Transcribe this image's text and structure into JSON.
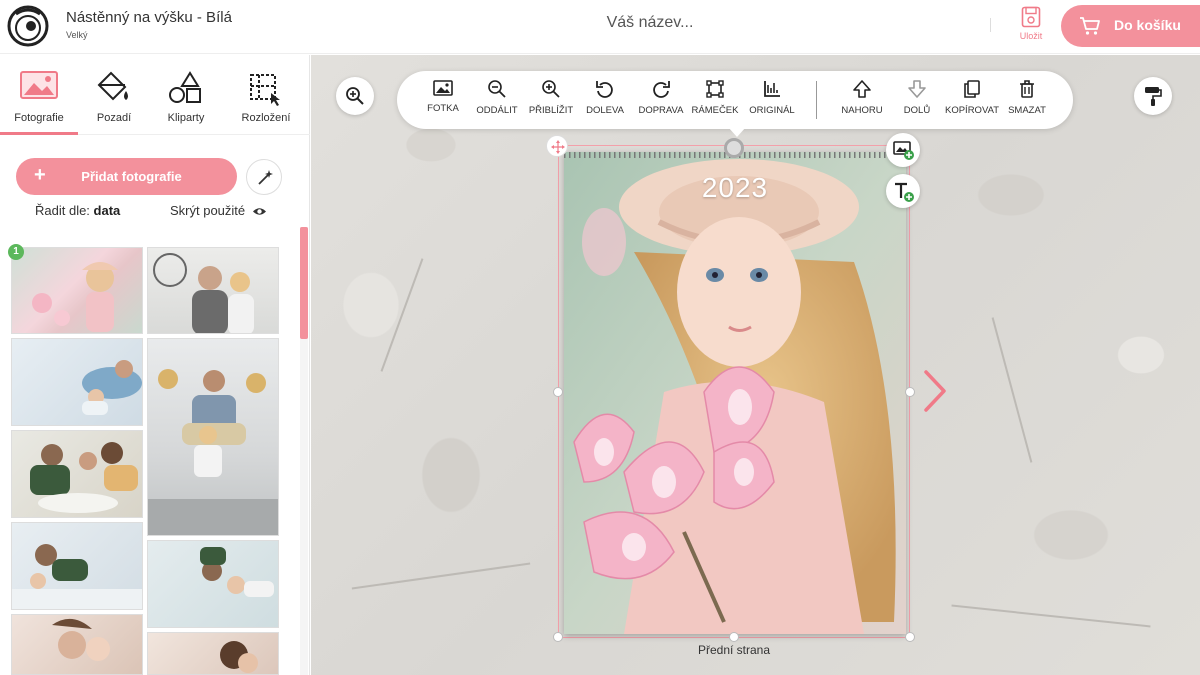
{
  "header": {
    "product_title": "Nástěnný na výšku - Bílá",
    "product_size": "Velký",
    "document_name": "Váš název...",
    "save_label": "Uložit",
    "cart_label": "Do košíku",
    "accent_color": "#f3919c"
  },
  "sidebar": {
    "tabs": [
      {
        "label": "Fotografie",
        "icon": "photo-icon",
        "active": true
      },
      {
        "label": "Pozadí",
        "icon": "paint-bucket-icon",
        "active": false
      },
      {
        "label": "Kliparty",
        "icon": "shapes-icon",
        "active": false
      },
      {
        "label": "Rozložení",
        "icon": "layout-grid-icon",
        "active": false
      }
    ],
    "add_photos_label": "Přidat fotografie",
    "sort_label": "Řadit dle:",
    "sort_value": "data",
    "hide_used_label": "Skrýt použité",
    "used_badge": "1"
  },
  "toolbar": {
    "tools": [
      {
        "label": "FOTKA",
        "icon": "image-icon"
      },
      {
        "label": "ODDÁLIT",
        "icon": "zoom-out-icon"
      },
      {
        "label": "PŘIBLÍŽIT",
        "icon": "zoom-in-icon"
      },
      {
        "label": "DOLEVA",
        "icon": "rotate-left-icon"
      },
      {
        "label": "DOPRAVA",
        "icon": "rotate-right-icon"
      },
      {
        "label": "RÁMEČEK",
        "icon": "frame-icon"
      },
      {
        "label": "ORIGINÁL",
        "icon": "original-size-icon"
      },
      {
        "label": "NAHORU",
        "icon": "arrow-up-icon"
      },
      {
        "label": "DOLŮ",
        "icon": "arrow-down-icon"
      },
      {
        "label": "KOPÍROVAT",
        "icon": "copy-icon"
      },
      {
        "label": "SMAZAT",
        "icon": "trash-icon"
      }
    ]
  },
  "canvas": {
    "year": "2023",
    "page_label": "Přední strana"
  }
}
